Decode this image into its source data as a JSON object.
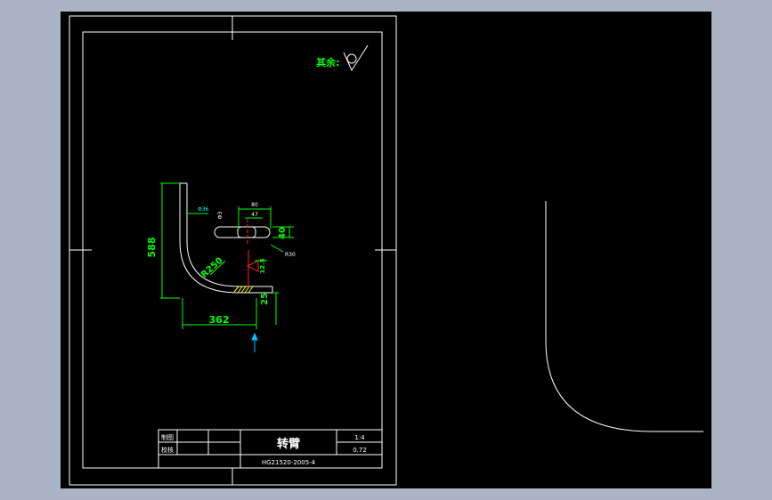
{
  "colors": {
    "background": "#000000",
    "desktop": "#aab4c4",
    "frame": "#ffffff",
    "dimension": "#00ff00",
    "part": "#ffffff",
    "cutline": "#ff2020",
    "hatch": "#ffff00",
    "arrow": "#00bfff",
    "leader": "#00ffff"
  },
  "drawing": {
    "surface_note": "其余:",
    "dimensions": {
      "height": "588",
      "width": "362",
      "radius": "R250",
      "pipe_dia": "Φ36",
      "bar_length": "80",
      "bar_inner": "47",
      "bar_left": "Φ3",
      "bar_height": "40",
      "bar_right": "R30",
      "roughness": "12.5",
      "bottom_thick": "25"
    },
    "title_block": {
      "label_drawn": "制图",
      "label_checked": "校核",
      "part_name": "转臂",
      "scale": "1:4",
      "weight": "0.72",
      "drawing_number": "HG21520-2005-4"
    }
  }
}
